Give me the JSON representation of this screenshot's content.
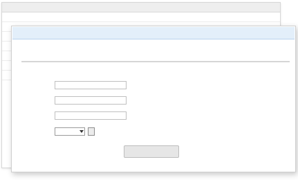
{
  "background_table": {
    "headers": [
      "",
      "",
      "",
      "",
      ""
    ],
    "rows": [
      [
        "",
        "",
        "",
        "",
        ""
      ],
      [
        "",
        "",
        "",
        "",
        ""
      ],
      [
        "",
        "",
        "",
        "",
        ""
      ],
      [
        "",
        "",
        "",
        "",
        ""
      ],
      [
        "",
        "",
        "",
        "",
        ""
      ],
      [
        "",
        "",
        "",
        "",
        ""
      ],
      [
        "",
        "",
        "",
        "",
        ""
      ]
    ]
  },
  "dialog": {
    "notice": "",
    "breadcrumb": {
      "section": "",
      "separator": "",
      "current": ""
    },
    "top_link": "",
    "form": {
      "full_name_label": "",
      "full_name_hint": "",
      "short_name_label": "",
      "short_name_hint": "",
      "keywords_label": "",
      "keywords_hint": "",
      "region_label": "",
      "region_value": "",
      "region_button": "",
      "region_hint": ""
    },
    "submit_label": ""
  },
  "colors": {
    "notice_bg": "#e3effa",
    "notice_text": "#1f5ea8",
    "top_link": "#cc3300",
    "hint": "#6f8fb4"
  }
}
